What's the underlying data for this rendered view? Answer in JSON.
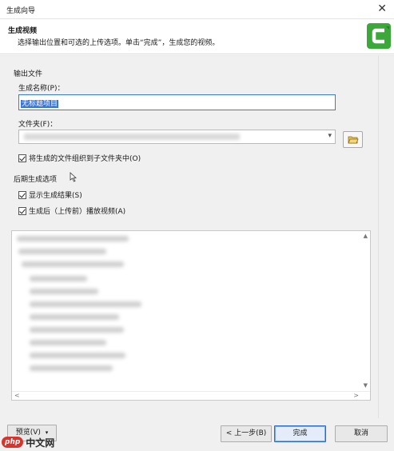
{
  "window": {
    "title": "生成向导",
    "close_glyph": "✕"
  },
  "header": {
    "title": "生成视频",
    "subtitle": "选择输出位置和可选的上传选项。单击“完成”，生成您的视频。",
    "logo_icon": "camtasia-logo-icon",
    "logo_color": "#3ca83a"
  },
  "output_section": {
    "label": "输出文件",
    "name_label": "生成名称(P)：",
    "name_value": "无标题项目",
    "folder_label": "文件夹(F)：",
    "folder_value": "",
    "browse_icon": "folder-open-icon",
    "organize_checkbox": {
      "label": "将生成的文件组织到子文件夹中(O)",
      "checked": true
    }
  },
  "post_section": {
    "label": "后期生成选项",
    "options": [
      {
        "label": "显示生成结果(S)",
        "checked": true
      },
      {
        "label": "生成后（上传前）播放视频(A)",
        "checked": true
      }
    ]
  },
  "footer": {
    "preview_label": "预览(V)",
    "back_label": "< 上一步(B)",
    "finish_label": "完成",
    "cancel_label": "取消"
  },
  "watermark": {
    "badge": "php",
    "text": "中文网"
  }
}
